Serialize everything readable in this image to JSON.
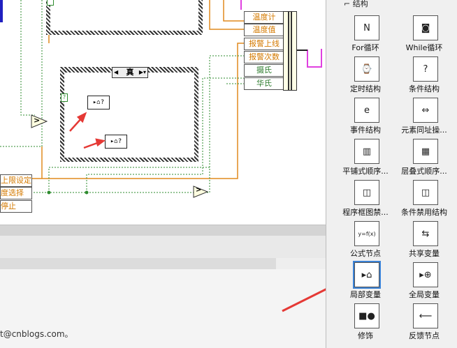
{
  "canvas": {
    "case_selector": "真",
    "local_var_label": "▸⌂?",
    "cluster_items": [
      {
        "label": "温度计",
        "color": "orange"
      },
      {
        "label": "温度值",
        "color": "orange"
      },
      {
        "label": "报警上线",
        "color": "orange"
      },
      {
        "label": "报警次数",
        "color": "orange"
      },
      {
        "label": "摄氏",
        "color": "green"
      },
      {
        "label": "华氏",
        "color": "green"
      }
    ],
    "left_boxes": [
      "上限设定",
      "度选择",
      "停止"
    ],
    "compare_symbol": ">",
    "not_symbol": ">"
  },
  "credit": "t@cnblogs.com。",
  "palette": {
    "header": "结构",
    "items": [
      {
        "label": "For循环",
        "icon": "for-loop-icon"
      },
      {
        "label": "While循环",
        "icon": "while-loop-icon"
      },
      {
        "label": "定时结构",
        "icon": "timed-structure-icon"
      },
      {
        "label": "条件结构",
        "icon": "case-structure-icon"
      },
      {
        "label": "事件结构",
        "icon": "event-structure-icon"
      },
      {
        "label": "元素同址操...",
        "icon": "in-place-structure-icon"
      },
      {
        "label": "平铺式顺序...",
        "icon": "flat-sequence-icon"
      },
      {
        "label": "层叠式顺序...",
        "icon": "stacked-sequence-icon"
      },
      {
        "label": "程序框图禁...",
        "icon": "diagram-disable-icon"
      },
      {
        "label": "条件禁用结构",
        "icon": "conditional-disable-icon"
      },
      {
        "label": "公式节点",
        "icon": "formula-node-icon"
      },
      {
        "label": "共享变量",
        "icon": "shared-variable-icon"
      },
      {
        "label": "局部变量",
        "icon": "local-variable-icon"
      },
      {
        "label": "全局变量",
        "icon": "global-variable-icon"
      },
      {
        "label": "修饰",
        "icon": "decorations-icon"
      },
      {
        "label": "反馈节点",
        "icon": "feedback-node-icon"
      }
    ],
    "selected": "局部变量"
  },
  "colors": {
    "wire_orange": "#e08a1e",
    "wire_green": "#2e8b2e",
    "wire_pink": "#e040e0",
    "annotation_red": "#e53935",
    "selection_blue": "#3b82d6"
  }
}
